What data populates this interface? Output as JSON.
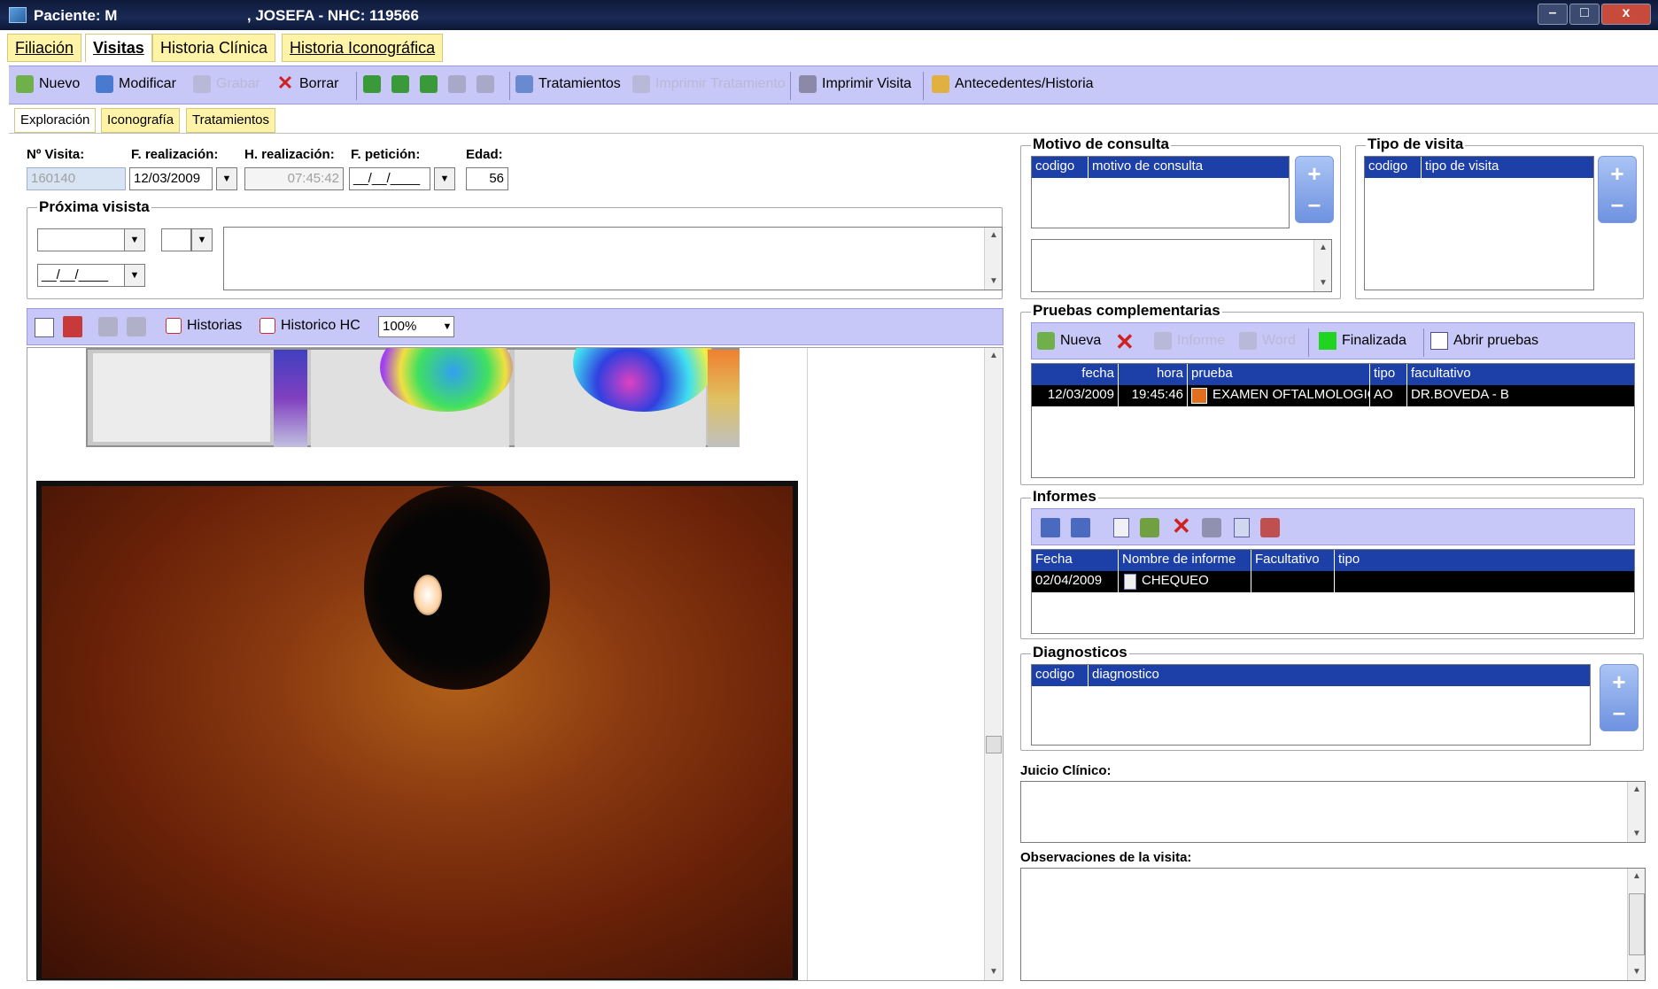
{
  "window": {
    "title": "Paciente: M                               , JOSEFA - NHC: 119566"
  },
  "menu_tabs": [
    "Filiación",
    "Visitas",
    "Historia Clínica",
    "Historia Iconográfica"
  ],
  "toolbar": {
    "nuevo": "Nuevo",
    "modificar": "Modificar",
    "grabar": "Grabar",
    "borrar": "Borrar",
    "tratamientos": "Tratamientos",
    "imprimir_tratamiento": "Imprimir Tratamiento",
    "imprimir_visita": "Imprimir Visita",
    "antecedentes": "Antecedentes/Historia"
  },
  "sub_tabs": [
    "Exploración",
    "Iconografía",
    "Tratamientos"
  ],
  "visit": {
    "n_visita_label": "Nº Visita:",
    "n_visita": "160140",
    "f_realizacion_label": "F. realización:",
    "f_realizacion": "12/03/2009",
    "h_realizacion_label": "H. realización:",
    "h_realizacion": "07:45:42",
    "f_peticion_label": "F. petición:",
    "f_peticion": "__/__/____",
    "edad_label": "Edad:",
    "edad": "56"
  },
  "proxima": {
    "label": "Próxima visista",
    "date": "__/__/____"
  },
  "image_toolbar": {
    "historias": "Historias",
    "historico": "Historico HC",
    "zoom": "100%"
  },
  "motivo": {
    "title": "Motivo de consulta",
    "col_codigo": "codigo",
    "col_motivo": "motivo de consulta"
  },
  "tipo_visita": {
    "title": "Tipo de visita",
    "col_codigo": "codigo",
    "col_tipo": "tipo de visita"
  },
  "pruebas": {
    "title": "Pruebas complementarias",
    "nueva": "Nueva",
    "informe": "Informe",
    "word": "Word",
    "finalizada": "Finalizada",
    "abrir": "Abrir pruebas",
    "cols": [
      "fecha",
      "hora",
      "prueba",
      "tipo",
      "facultativo"
    ],
    "rows": [
      [
        "12/03/2009",
        "19:45:46",
        "EXAMEN OFTALMOLOGIC",
        "AO",
        "DR.BOVEDA - B"
      ]
    ]
  },
  "informes": {
    "title": "Informes",
    "cols": [
      "Fecha",
      "Nombre de informe",
      "Facultativo",
      "tipo"
    ],
    "rows": [
      [
        "02/04/2009",
        "CHEQUEO",
        "",
        ""
      ]
    ]
  },
  "diagnosticos": {
    "title": "Diagnosticos",
    "col_codigo": "codigo",
    "col_diag": "diagnostico"
  },
  "juicio": {
    "label": "Juicio Clínico:"
  },
  "observaciones": {
    "label": "Observaciones de la visita:"
  }
}
